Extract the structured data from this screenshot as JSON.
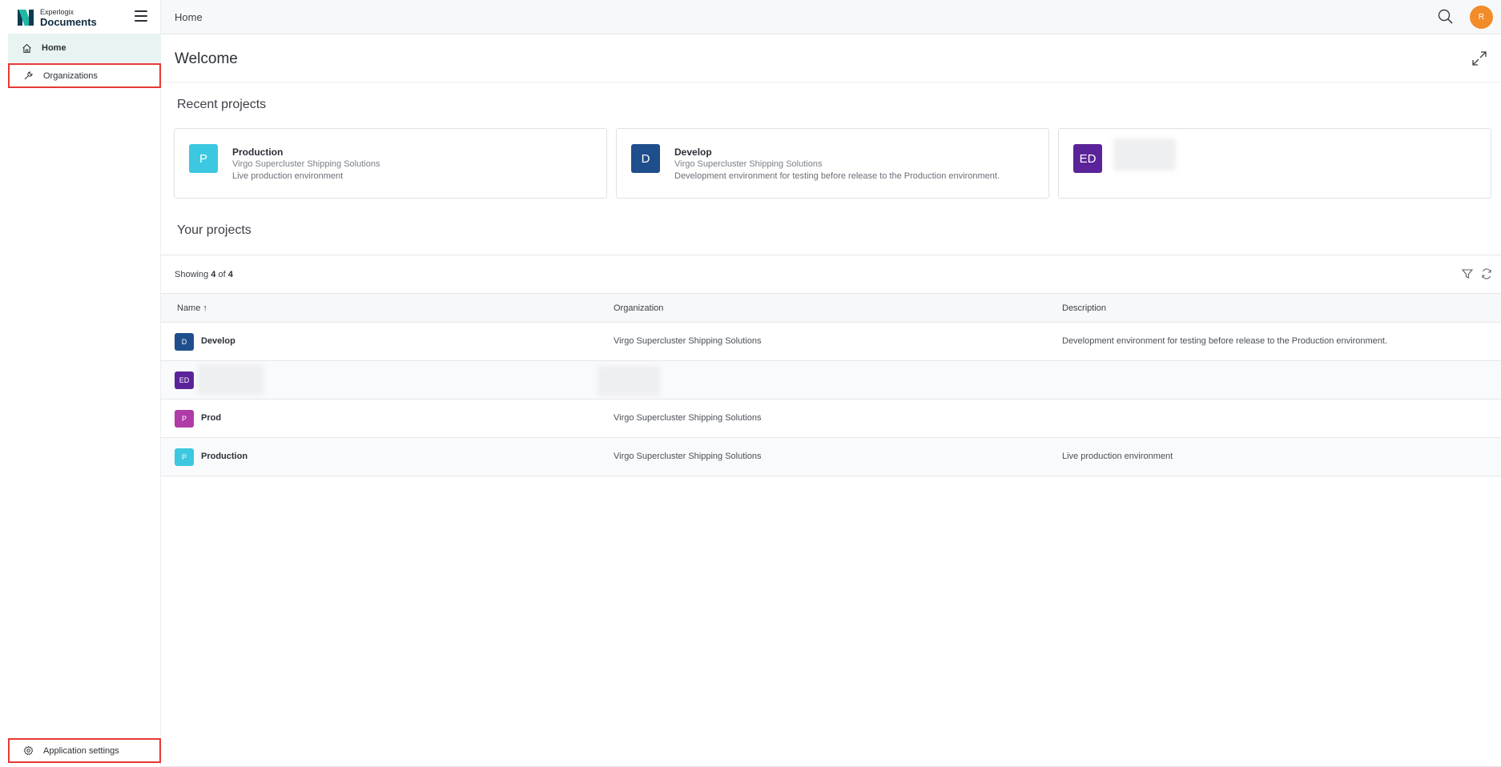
{
  "brand": {
    "top": "Experlogix",
    "main": "Documents"
  },
  "sidebar": {
    "items": [
      {
        "label": "Home",
        "icon": "home-icon"
      },
      {
        "label": "Organizations",
        "icon": "wrench-icon"
      }
    ],
    "footer": {
      "label": "Application settings",
      "icon": "gear-icon"
    }
  },
  "topbar": {
    "breadcrumb": "Home",
    "avatar_initial": "R"
  },
  "welcome": {
    "title": "Welcome"
  },
  "recent": {
    "title": "Recent projects",
    "cards": [
      {
        "initials": "P",
        "name": "Production",
        "org": "Virgo Supercluster Shipping Solutions",
        "desc": "Live production environment",
        "color": "#3cc8e0"
      },
      {
        "initials": "D",
        "name": "Develop",
        "org": "Virgo Supercluster Shipping Solutions",
        "desc": "Development environment for testing before release to the Production environment.",
        "color": "#1f4e8c"
      },
      {
        "initials": "ED",
        "name": "",
        "org": "",
        "desc": "",
        "color": "#5b2399"
      }
    ]
  },
  "projects": {
    "title": "Your projects",
    "showing_prefix": "Showing",
    "showing_count": "4",
    "showing_of": "of",
    "showing_total": "4",
    "columns": {
      "name": "Name",
      "sort_indicator": "↑",
      "organization": "Organization",
      "description": "Description"
    },
    "rows": [
      {
        "initials": "D",
        "name": "Develop",
        "org": "Virgo Supercluster Shipping Solutions",
        "desc": "Development environment for testing before release to the Production environment.",
        "color": "#1f4e8c"
      },
      {
        "initials": "ED",
        "name": "",
        "org": "",
        "desc": "",
        "color": "#5b2399"
      },
      {
        "initials": "P",
        "name": "Prod",
        "org": "Virgo Supercluster Shipping Solutions",
        "desc": "",
        "color": "#b03aa8"
      },
      {
        "initials": "P",
        "name": "Production",
        "org": "Virgo Supercluster Shipping Solutions",
        "desc": "Live production environment",
        "color": "#3cc8e0"
      }
    ]
  }
}
